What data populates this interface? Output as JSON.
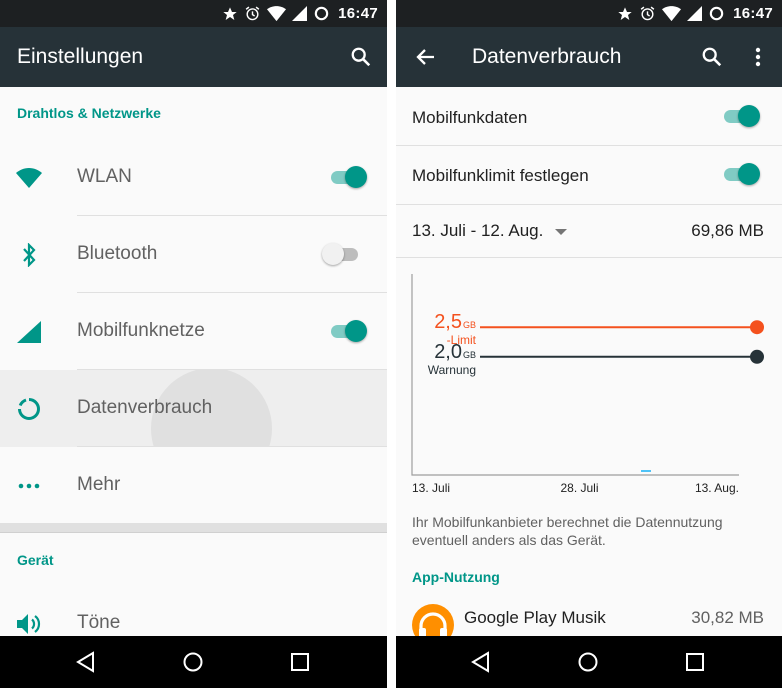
{
  "status": {
    "time": "16:47"
  },
  "left": {
    "title": "Einstellungen",
    "sections": [
      {
        "header": "Drahtlos & Netzwerke"
      },
      {
        "header": "Gerät"
      }
    ],
    "items": [
      {
        "label": "WLAN",
        "icon": "wifi-icon",
        "toggle": "on"
      },
      {
        "label": "Bluetooth",
        "icon": "bluetooth-icon",
        "toggle": "off"
      },
      {
        "label": "Mobilfunknetze",
        "icon": "cellular-signal-icon",
        "toggle": "on"
      },
      {
        "label": "Datenverbrauch",
        "icon": "data-usage-icon",
        "pressed": true
      },
      {
        "label": "Mehr",
        "icon": "more-dots-icon"
      },
      {
        "label": "Töne",
        "icon": "volume-icon"
      }
    ]
  },
  "right": {
    "title": "Datenverbrauch",
    "mobile_data": {
      "label": "Mobilfunkdaten",
      "toggle": "on"
    },
    "set_limit": {
      "label": "Mobilfunklimit festlegen",
      "toggle": "on"
    },
    "cycle": {
      "label": "13. Juli - 12. Aug.",
      "value": "69,86 MB"
    },
    "note": "Ihr Mobilfunkanbieter berechnet die Datennutzung eventuell anders als das Gerät.",
    "app_usage_header": "App-Nutzung",
    "apps": [
      {
        "name": "Google Play Musik",
        "size": "30,82 MB"
      }
    ]
  },
  "chart_data": {
    "type": "line",
    "x_ticks": [
      "13. Juli",
      "28. Juli",
      "13. Aug."
    ],
    "thresholds": [
      {
        "value_big": "2,5",
        "unit": "GB",
        "label": "-Limit",
        "value_gb": 2.5,
        "color": "#f4511e"
      },
      {
        "value_big": "2,0",
        "unit": "GB",
        "label": "Warnung",
        "value_gb": 2.0,
        "color": "#263238"
      }
    ],
    "usage_mb": 69.86,
    "usage_color": "#4fc3f7"
  },
  "colors": {
    "accent": "#009688",
    "toolbar": "#263238",
    "statusbar": "#1d2022",
    "limit": "#f4511e"
  }
}
